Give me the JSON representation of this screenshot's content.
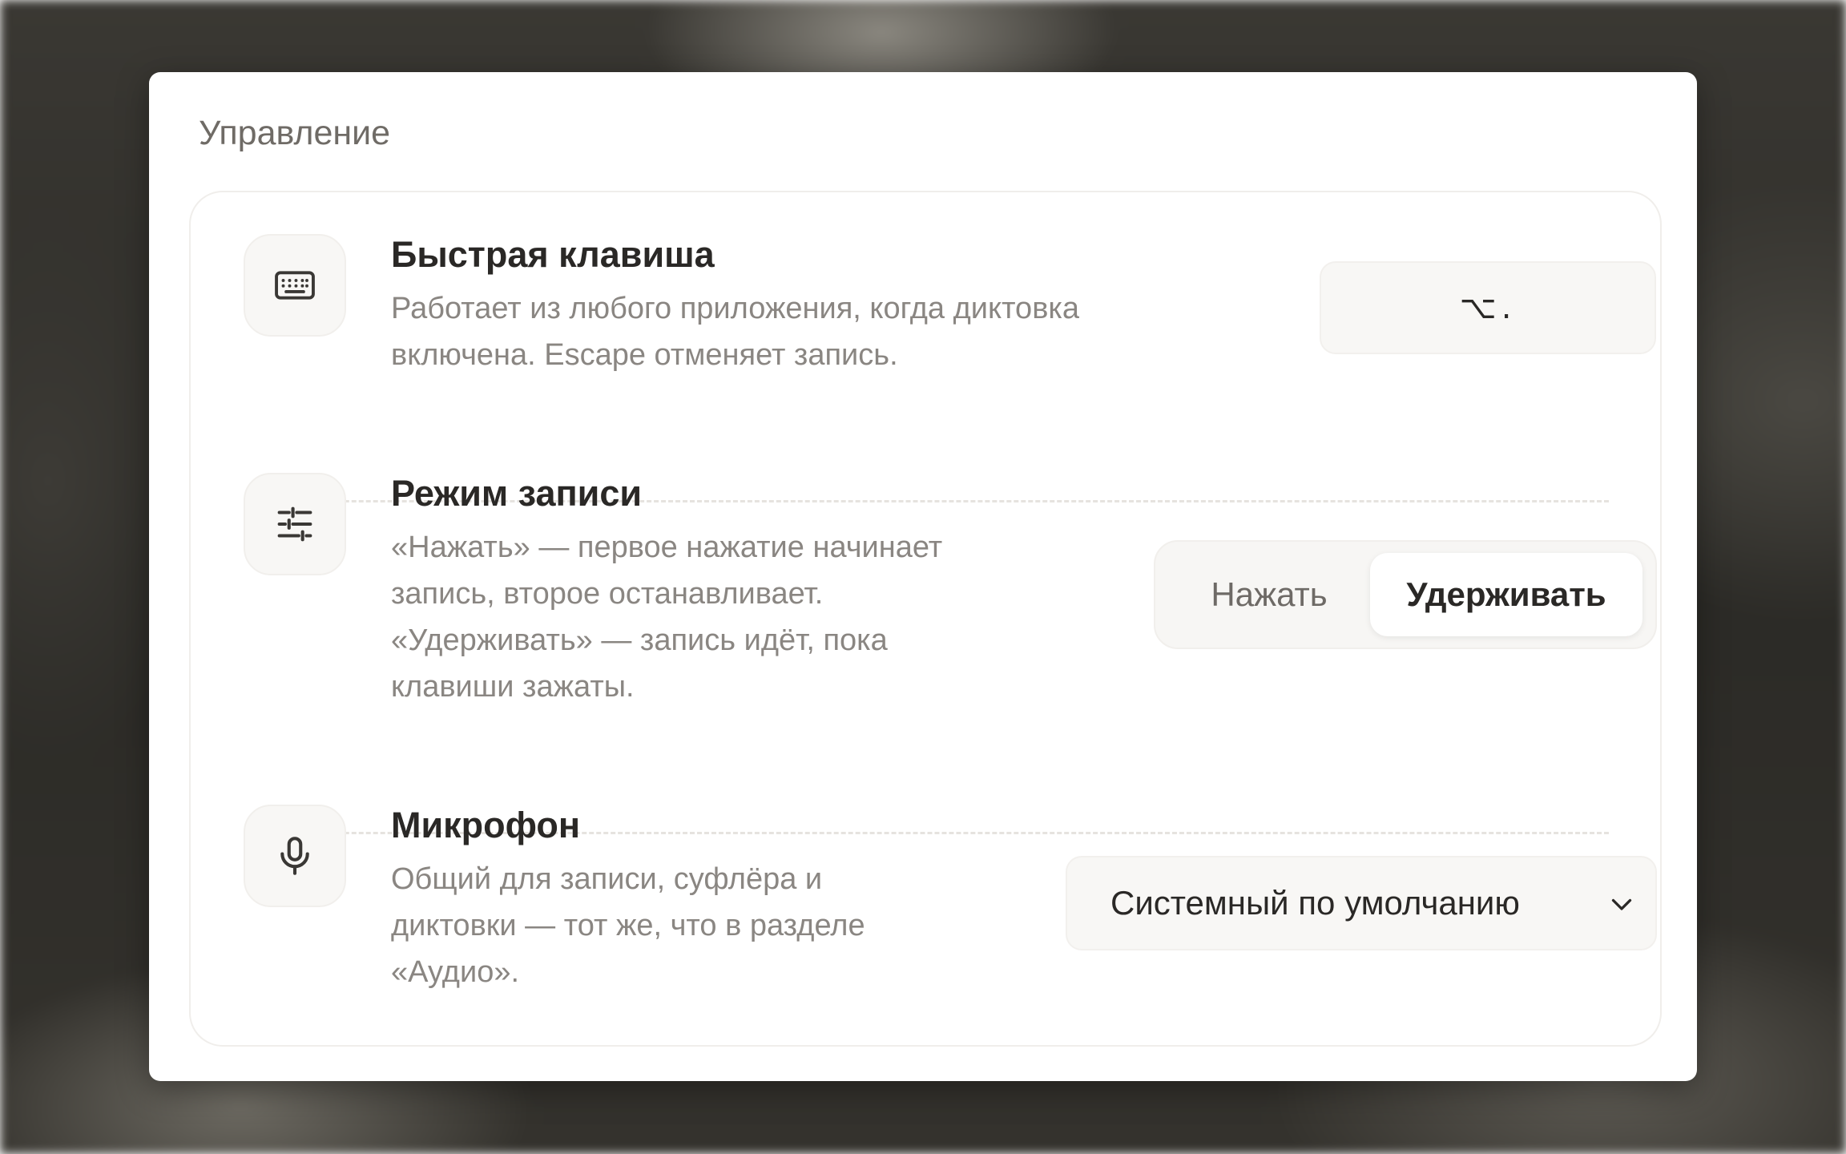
{
  "section": {
    "title": "Управление"
  },
  "rows": {
    "hotkey": {
      "icon": "keyboard-icon",
      "title": "Быстрая клавиша",
      "desc_line1": "Работает из любого приложения, когда диктовка",
      "desc_line2": "включена. Escape отменяет запись.",
      "shortcut": "⌥."
    },
    "mode": {
      "icon": "sliders-icon",
      "title": "Режим записи",
      "desc_line1": "«Нажать» — первое нажатие начинает",
      "desc_line2": "запись, второе останавливает.",
      "desc_line3": "«Удерживать» — запись идёт, пока",
      "desc_line4": "клавиши зажаты.",
      "options": [
        "Нажать",
        "Удерживать"
      ],
      "selected": "Удерживать"
    },
    "microphone": {
      "icon": "microphone-icon",
      "title": "Микрофон",
      "desc_line1": "Общий для записи, суфлёра и",
      "desc_line2": "диктовки — тот же, что в разделе",
      "desc_line3": "«Аудио».",
      "selected_value": "Системный по умолчанию"
    }
  },
  "colors": {
    "text_primary": "#2a2826",
    "text_secondary": "#8a8682",
    "panel_bg": "#ffffff",
    "control_bg": "#f8f7f5"
  }
}
